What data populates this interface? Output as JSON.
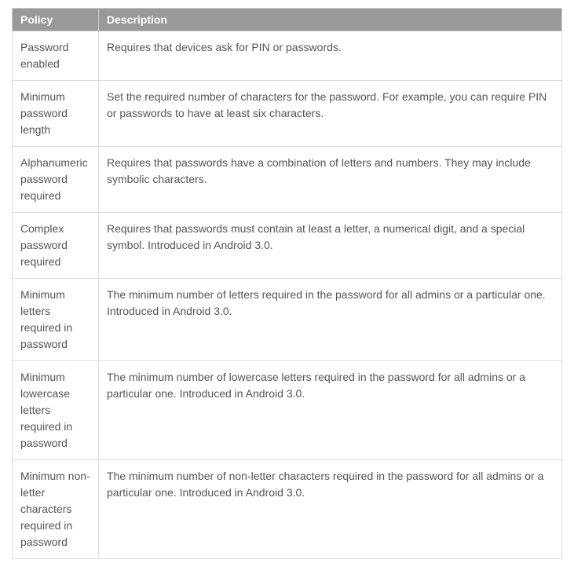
{
  "table": {
    "headers": [
      "Policy",
      "Description"
    ],
    "rows": [
      {
        "policy": "Password enabled",
        "description": "Requires that devices ask for PIN or passwords."
      },
      {
        "policy": "Minimum password length",
        "description": "Set the required number of characters for the password. For example, you can require PIN or passwords to have at least six characters."
      },
      {
        "policy": "Alphanumeric password required",
        "description": "Requires that passwords have a combination of letters and numbers. They may include symbolic characters."
      },
      {
        "policy": "Complex password required",
        "description": "Requires that passwords must contain at least a letter, a numerical digit, and a special symbol. Introduced in Android 3.0."
      },
      {
        "policy": "Minimum letters required in password",
        "description": "The minimum number of letters required in the password for all admins or a particular one. Introduced in Android 3.0."
      },
      {
        "policy": "Minimum lowercase letters required in password",
        "description": "The minimum number of lowercase letters required in the password for all admins or a particular one. Introduced in Android 3.0."
      },
      {
        "policy": "Minimum non-letter characters required in password",
        "description": "The minimum number of non-letter characters required in the password for all admins or a particular one. Introduced in Android 3.0."
      }
    ]
  }
}
